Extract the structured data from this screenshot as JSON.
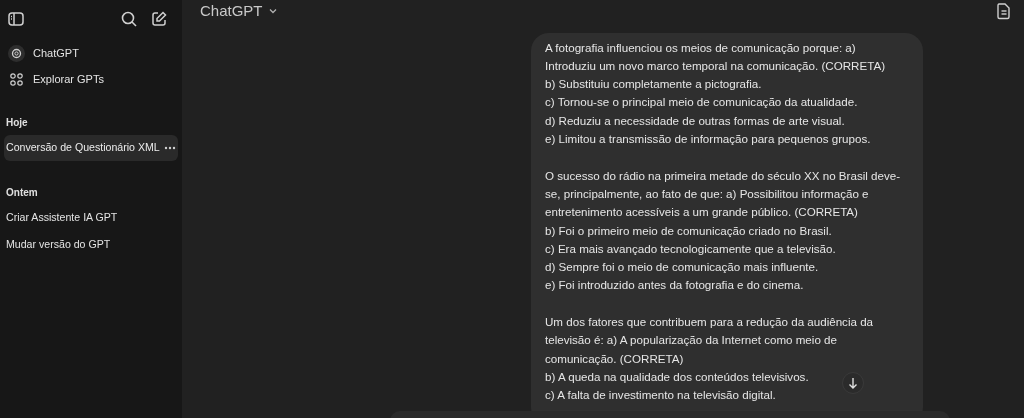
{
  "sidebar": {
    "nav": [
      {
        "kind": "logo",
        "label": "ChatGPT"
      },
      {
        "kind": "grid",
        "label": "Explorar GPTs"
      }
    ],
    "sections": [
      {
        "heading": "Hoje",
        "items": [
          {
            "label": "Conversão de Questionário XML",
            "selected": true
          }
        ]
      },
      {
        "heading": "Ontem",
        "items": [
          {
            "label": "Criar Assistente IA GPT",
            "selected": false
          },
          {
            "label": "Mudar versão do GPT",
            "selected": false
          }
        ]
      }
    ]
  },
  "header": {
    "model": "ChatGPT"
  },
  "message": {
    "paragraphs": [
      [
        "A fotografia influenciou os meios de comunicação porque: a) Introduziu um novo marco temporal na comunicação. (CORRETA)",
        "b) Substituiu completamente a pictografia.",
        "c) Tornou-se o principal meio de comunicação da atualidade.",
        "d) Reduziu a necessidade de outras formas de arte visual.",
        "e) Limitou a transmissão de informação para pequenos grupos."
      ],
      [
        "O sucesso do rádio na primeira metade do século XX no Brasil deve-se, principalmente, ao fato de que: a) Possibilitou informação e entretenimento acessíveis a um grande público. (CORRETA)",
        "b) Foi o primeiro meio de comunicação criado no Brasil.",
        "c) Era mais avançado tecnologicamente que a televisão.",
        "d) Sempre foi o meio de comunicação mais influente.",
        "e) Foi introduzido antes da fotografia e do cinema."
      ],
      [
        "Um dos fatores que contribuem para a redução da audiência da televisão é: a) A popularização da Internet como meio de comunicação. (CORRETA)",
        "b) A queda na qualidade dos conteúdos televisivos.",
        "c) A falta de investimento na televisão digital."
      ]
    ]
  }
}
